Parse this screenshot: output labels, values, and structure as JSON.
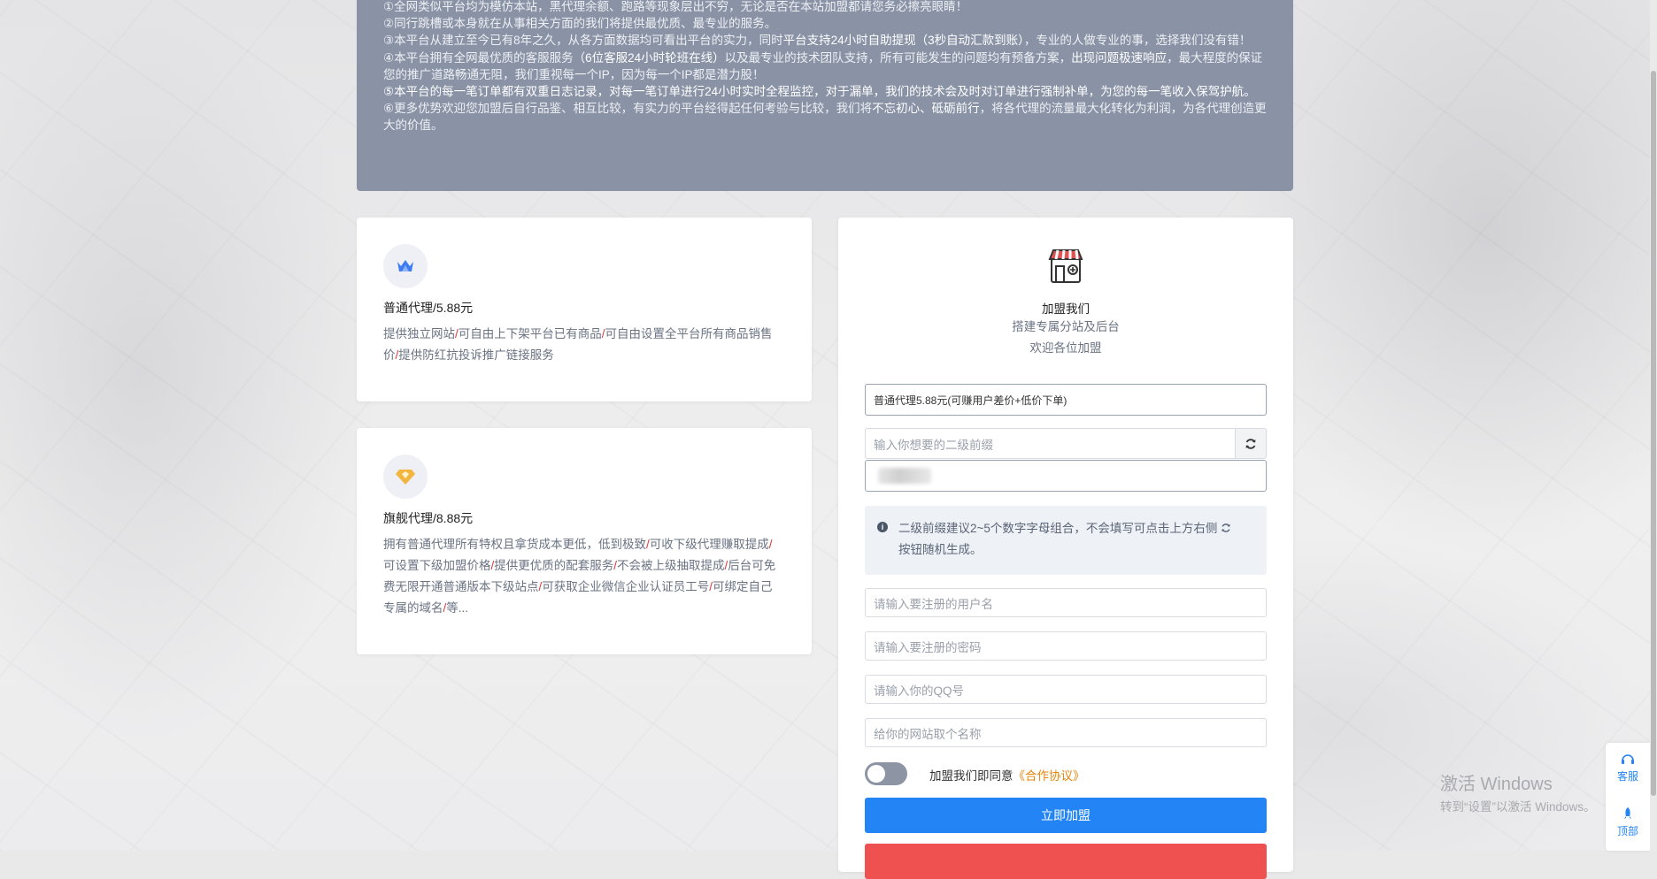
{
  "notice": {
    "l1": "①全网类似平台均为模仿本站，黑代理余额、跑路等现象层出不穷，无论是否在本站加盟都请您务必擦亮眼睛！",
    "l2": "②同行跳槽或本身就在从事相关方面的我们将提供最优质、最专业的服务。",
    "l3a": "③本平台从建立至今已有8年之久，从各方面数据均可看出平台的实力，同时",
    "l3b": "平台支持24小时自助提现（3秒自动汇款到账）",
    "l3c": "，专业的人做专业的事，选择我们没有错！",
    "l4a": "④本平台拥有全网最优质的客服服务",
    "l4b": "（6位客服24小时轮班在线）",
    "l4c": "以及最专业的技术团队支持，所有可能发生的问题均有预备方案，",
    "l4d": "出现问题极速响应",
    "l4e": "，最大程度的保证您的推广道路畅通无阻，我们重视每一个IP，因为每一个IP都是潜力股！",
    "l5": "⑤本平台的每一笔订单都有双重日志记录，对每一笔订单进行24小时实时全程监控，对于漏单，我们的技术会及时对订单进行强制补单，为您的每一笔收入保驾护航。",
    "l6a": "⑥更多优势欢迎您加盟后自行品鉴、相互比较，有实力的平台经得起任何考验与比较，我们将",
    "l6b": "不忘初心、砥砺前行",
    "l6c": "，将各代理的流量最大化转化为利润，为各代理创造更大的价值。"
  },
  "plan1": {
    "title": "普通代理/5.88元",
    "features": [
      "提供独立网站",
      "可自由上下架平台已有商品",
      "可自由设置全平台所有商品销售价",
      "提供防红抗投诉推广链接服务"
    ]
  },
  "plan2": {
    "title": "旗舰代理/8.88元",
    "features": [
      "拥有普通代理所有特权且拿货成本更低，低到极致",
      "可收下级代理赚取提成",
      "可设置下级加盟价格",
      "提供更优质的配套服务",
      "不会被上级抽取提成",
      "后台可免费无限开通普通版本下级站点",
      "可获取企业微信企业认证员工号",
      "可绑定自己专属的域名",
      "等..."
    ]
  },
  "join": {
    "title": "加盟我们",
    "sub1": "搭建专属分站及后台",
    "sub2": "欢迎各位加盟",
    "plan_select": "普通代理5.88元(可赚用户差价+低价下单)",
    "prefix_placeholder": "输入你想要的二级前缀",
    "tip_a": "二级前缀建议2~5个数字字母组合，不会填写可点击上方右侧",
    "tip_b": "按钮随机生成。",
    "username_placeholder": "请输入要注册的用户名",
    "password_placeholder": "请输入要注册的密码",
    "qq_placeholder": "请输入你的QQ号",
    "sitename_placeholder": "给你的网站取个名称",
    "agree_text": "加盟我们即同意",
    "agree_link": "《合作协议》",
    "submit": "立即加盟"
  },
  "watermark": {
    "line1": "激活 Windows",
    "line2": "转到“设置”以激活 Windows。"
  },
  "side": {
    "service": "客服",
    "top": "顶部"
  },
  "colors": {
    "accent": "#2384f6",
    "notice_bg": "#8a93a6",
    "link": "#e8860c",
    "danger": "#ef5050"
  }
}
